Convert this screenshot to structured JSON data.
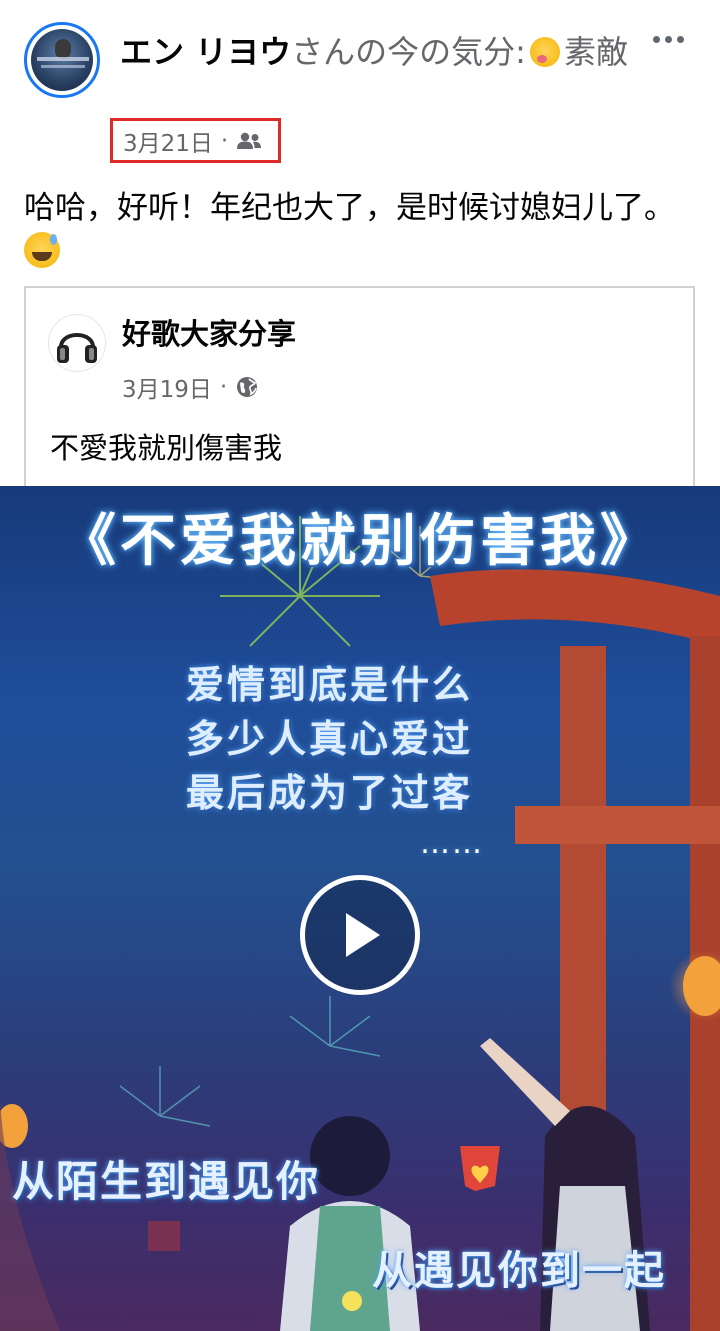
{
  "post": {
    "author_name": "エン リヨウ",
    "feeling_prefix": "さんの今の気分:",
    "feeling_emoji": "smiling-face-with-hearts-icon",
    "feeling_label": "素敵",
    "date": "3月21日",
    "separator": "·",
    "audience_icon": "friends-icon",
    "text": "哈哈，好听！年纪也大了，是时候讨媳妇儿了。",
    "text_emoji": "grinning-sweat-icon",
    "more_icon": "more-options-icon"
  },
  "shared": {
    "page_name": "好歌大家分享",
    "date": "3月19日",
    "separator": "·",
    "audience_icon": "globe-icon",
    "text": "不愛我就別傷害我"
  },
  "video": {
    "title": "《不爱我就别伤害我》",
    "lyrics": [
      "爱情到底是什么",
      "多少人真心爱过",
      "最后成为了过客"
    ],
    "ellipsis": "……",
    "subtitle_left": "从陌生到遇见你",
    "subtitle_right": "从遇见你到一起",
    "play_icon": "play-icon"
  },
  "colors": {
    "avatar_ring": "#1877f2",
    "highlight_box": "#e02a2a",
    "meta_text": "#65676b"
  }
}
